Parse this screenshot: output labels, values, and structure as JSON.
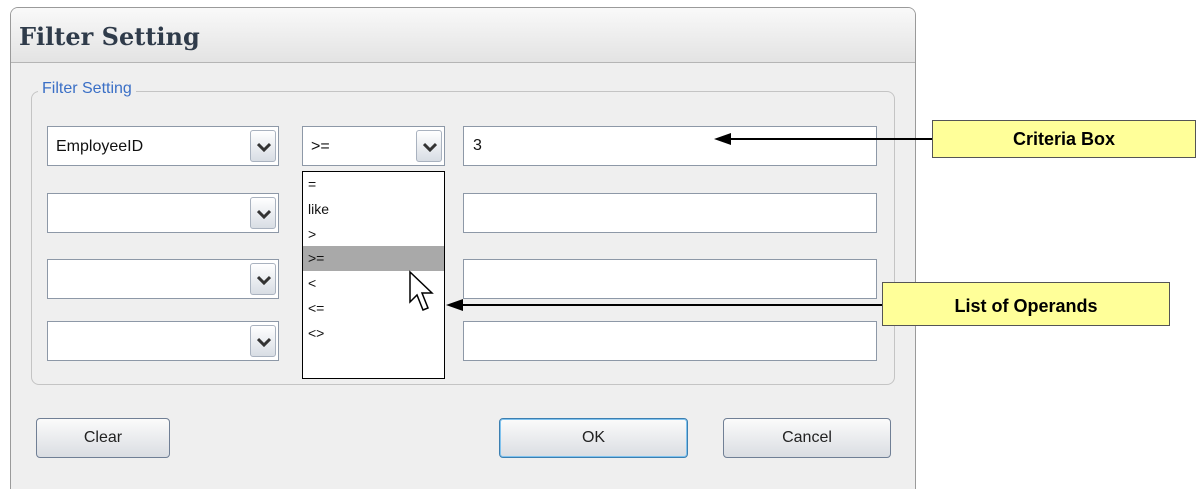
{
  "dialog": {
    "title": "Filter Setting",
    "group_label": "Filter Setting",
    "rows": [
      {
        "field": "EmployeeID",
        "operator": ">=",
        "criteria": "3"
      },
      {
        "field": "",
        "operator": "",
        "criteria": ""
      },
      {
        "field": "",
        "operator": "",
        "criteria": ""
      },
      {
        "field": "",
        "operator": "",
        "criteria": ""
      }
    ],
    "operator_options": [
      "=",
      "like",
      ">",
      ">=",
      "<",
      "<=",
      "<>"
    ],
    "selected_option_index": 3,
    "buttons": {
      "clear": "Clear",
      "ok": "OK",
      "cancel": "Cancel"
    }
  },
  "annotations": {
    "criteria_box": "Criteria Box",
    "list_of_operands": "List of Operands"
  },
  "colors": {
    "callout_fill": "#ffff99",
    "group_label": "#3a6fc6",
    "selected_option": "#a9a9a9"
  }
}
